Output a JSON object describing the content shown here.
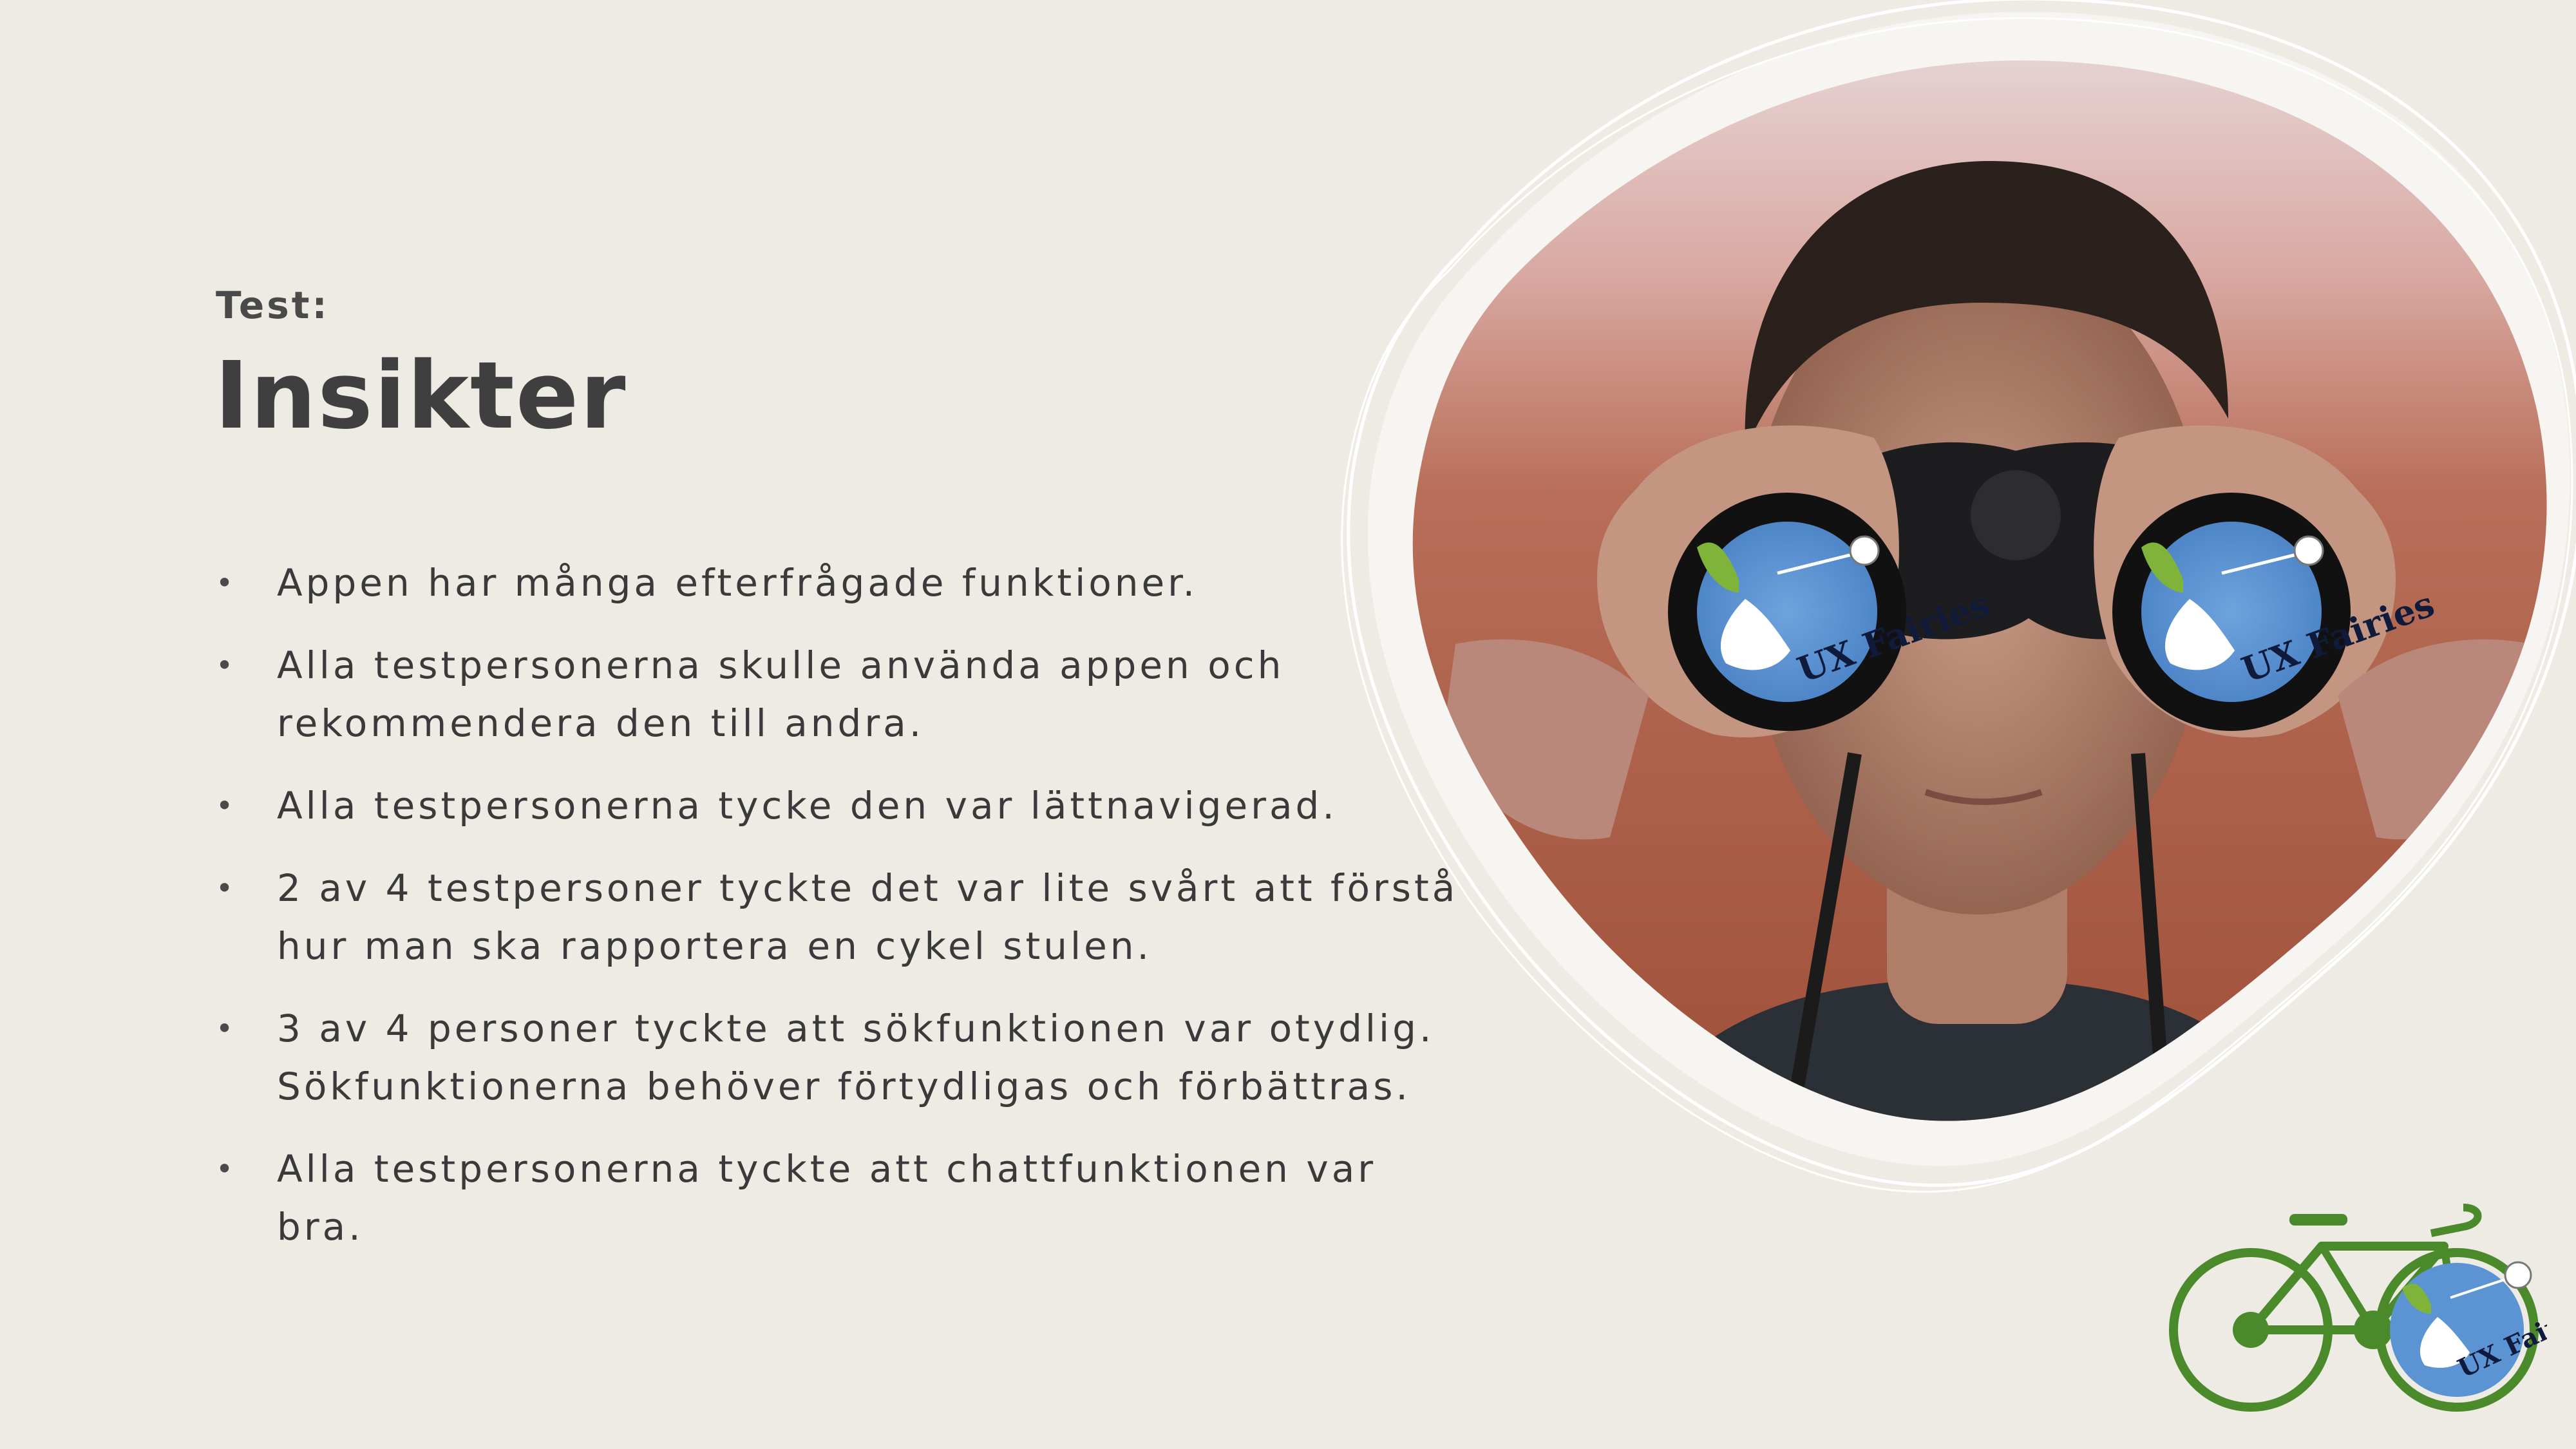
{
  "slide": {
    "kicker": "Test:",
    "title": "Insikter",
    "bullets": [
      "Appen har många efterfrågade funktioner.",
      "Alla testpersonerna skulle använda appen och rekommendera den till andra.",
      "Alla testpersonerna tycke den var lättnavigerad.",
      "2 av 4 testpersoner tyckte det var lite svårt att förstå hur man ska rapportera en cykel stulen.",
      "3 av 4 personer tyckte att sökfunktionen var otydlig. Sökfunktionerna behöver förtydligas och förbättras.",
      "Alla testpersonerna tyckte att chattfunktionen var bra."
    ]
  },
  "logos": {
    "left_badge": "UX Fairies",
    "right_badge": "UX Fairies",
    "bike_badge": "UX Fairies"
  },
  "colors": {
    "background": "#edebe4",
    "text": "#3a3a3a",
    "badge_blue": "#5b93d3",
    "bike_green": "#4a8a2a"
  }
}
